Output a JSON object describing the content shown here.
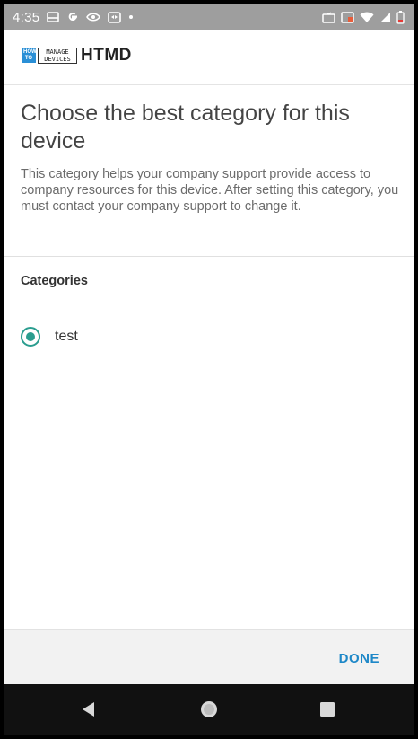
{
  "status_bar": {
    "time": "4:35",
    "left_icons": [
      "inbox-icon",
      "google-g-icon",
      "eye-icon",
      "cast-icon",
      "dot-icon"
    ],
    "right_icons": [
      "tv-icon",
      "cast-icon",
      "wifi-icon",
      "signal-icon",
      "battery-icon"
    ],
    "background_color": "#9e9e9e"
  },
  "header": {
    "logo_howto": "HOW TO",
    "logo_manage": "MANAGE DEVICES",
    "logo_text": "HTMD"
  },
  "main": {
    "title": "Choose the best category for this device",
    "description": "This category helps your company support provide access to company resources for this device. After setting this category, you must contact your company support to change it.",
    "categories_label": "Categories",
    "options": [
      {
        "label": "test",
        "selected": true
      }
    ]
  },
  "footer": {
    "done_label": "DONE"
  },
  "nav_bar": {
    "icons": [
      "back-icon",
      "home-icon",
      "recents-icon"
    ]
  },
  "colors": {
    "accent": "#2a9d8f",
    "action": "#1e88c8",
    "title_text": "#444444",
    "body_text": "#6b6b6b"
  }
}
